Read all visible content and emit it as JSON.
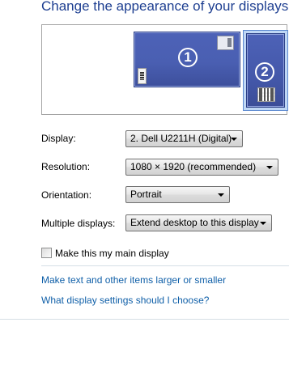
{
  "header": {
    "title": "Change the appearance of your displays"
  },
  "preview": {
    "monitors": [
      {
        "number": "1",
        "selected": false
      },
      {
        "number": "2",
        "selected": true
      }
    ]
  },
  "settings": {
    "display": {
      "label": "Display:",
      "value": "2. Dell U2211H (Digital)"
    },
    "resolution": {
      "label": "Resolution:",
      "value": "1080 × 1920 (recommended)"
    },
    "orientation": {
      "label": "Orientation:",
      "value": "Portrait"
    },
    "multiple_displays": {
      "label": "Multiple displays:",
      "value": "Extend desktop to this display"
    }
  },
  "main_display_checkbox": {
    "label": "Make this my main display",
    "checked": false
  },
  "links": {
    "text_size": "Make text and other items larger or smaller",
    "help": "What display settings should I choose?"
  },
  "colors": {
    "title": "#1e3f91",
    "link": "#0f5fa8",
    "monitor": "#4a5fb2",
    "selection": "#bfd7f5"
  }
}
